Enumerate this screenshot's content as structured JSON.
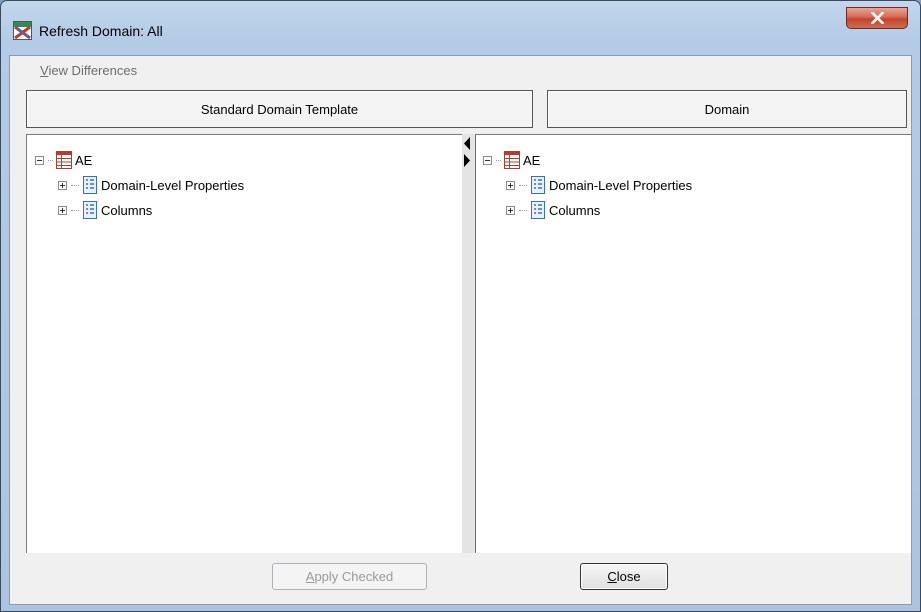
{
  "window": {
    "title": "Refresh Domain:  All"
  },
  "menu": {
    "view_differences": {
      "mnemonic": "V",
      "rest": "iew Differences"
    }
  },
  "headers": {
    "left": "Standard Domain Template",
    "right": "Domain"
  },
  "left_tree": {
    "root": "AE",
    "children": [
      "Domain-Level Properties",
      "Columns"
    ]
  },
  "right_tree": {
    "root": "AE",
    "children": [
      "Domain-Level Properties",
      "Columns"
    ]
  },
  "buttons": {
    "apply": {
      "mnemonic": "A",
      "rest": "pply Checked"
    },
    "close": {
      "mnemonic": "C",
      "rest": "lose"
    }
  },
  "colors": {
    "close_button": "#c4442a",
    "table_icon_red": "#c0392b",
    "list_icon_blue": "#3a6fc4"
  },
  "icons": {
    "title": "refresh-domain-icon",
    "close": "close-icon",
    "root": "domain-table-icon",
    "child": "property-list-icon",
    "splitter": "splitter-arrows-icon"
  }
}
